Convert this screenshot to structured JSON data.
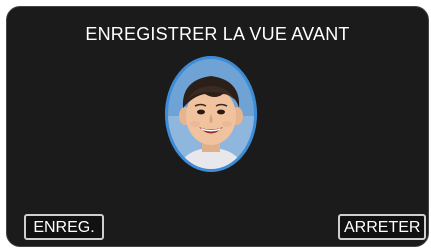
{
  "screen": {
    "title": "ENREGISTRER LA VUE AVANT"
  },
  "preview": {
    "subject": "smiling boy face inside oval guide frame",
    "frame_color": "#3f8cd6"
  },
  "buttons": {
    "record_label": "ENREG.",
    "stop_label": "ARRETER"
  },
  "colors": {
    "background": "#1b1b1b",
    "text": "#ffffff",
    "button_border": "#cfcfcf"
  }
}
